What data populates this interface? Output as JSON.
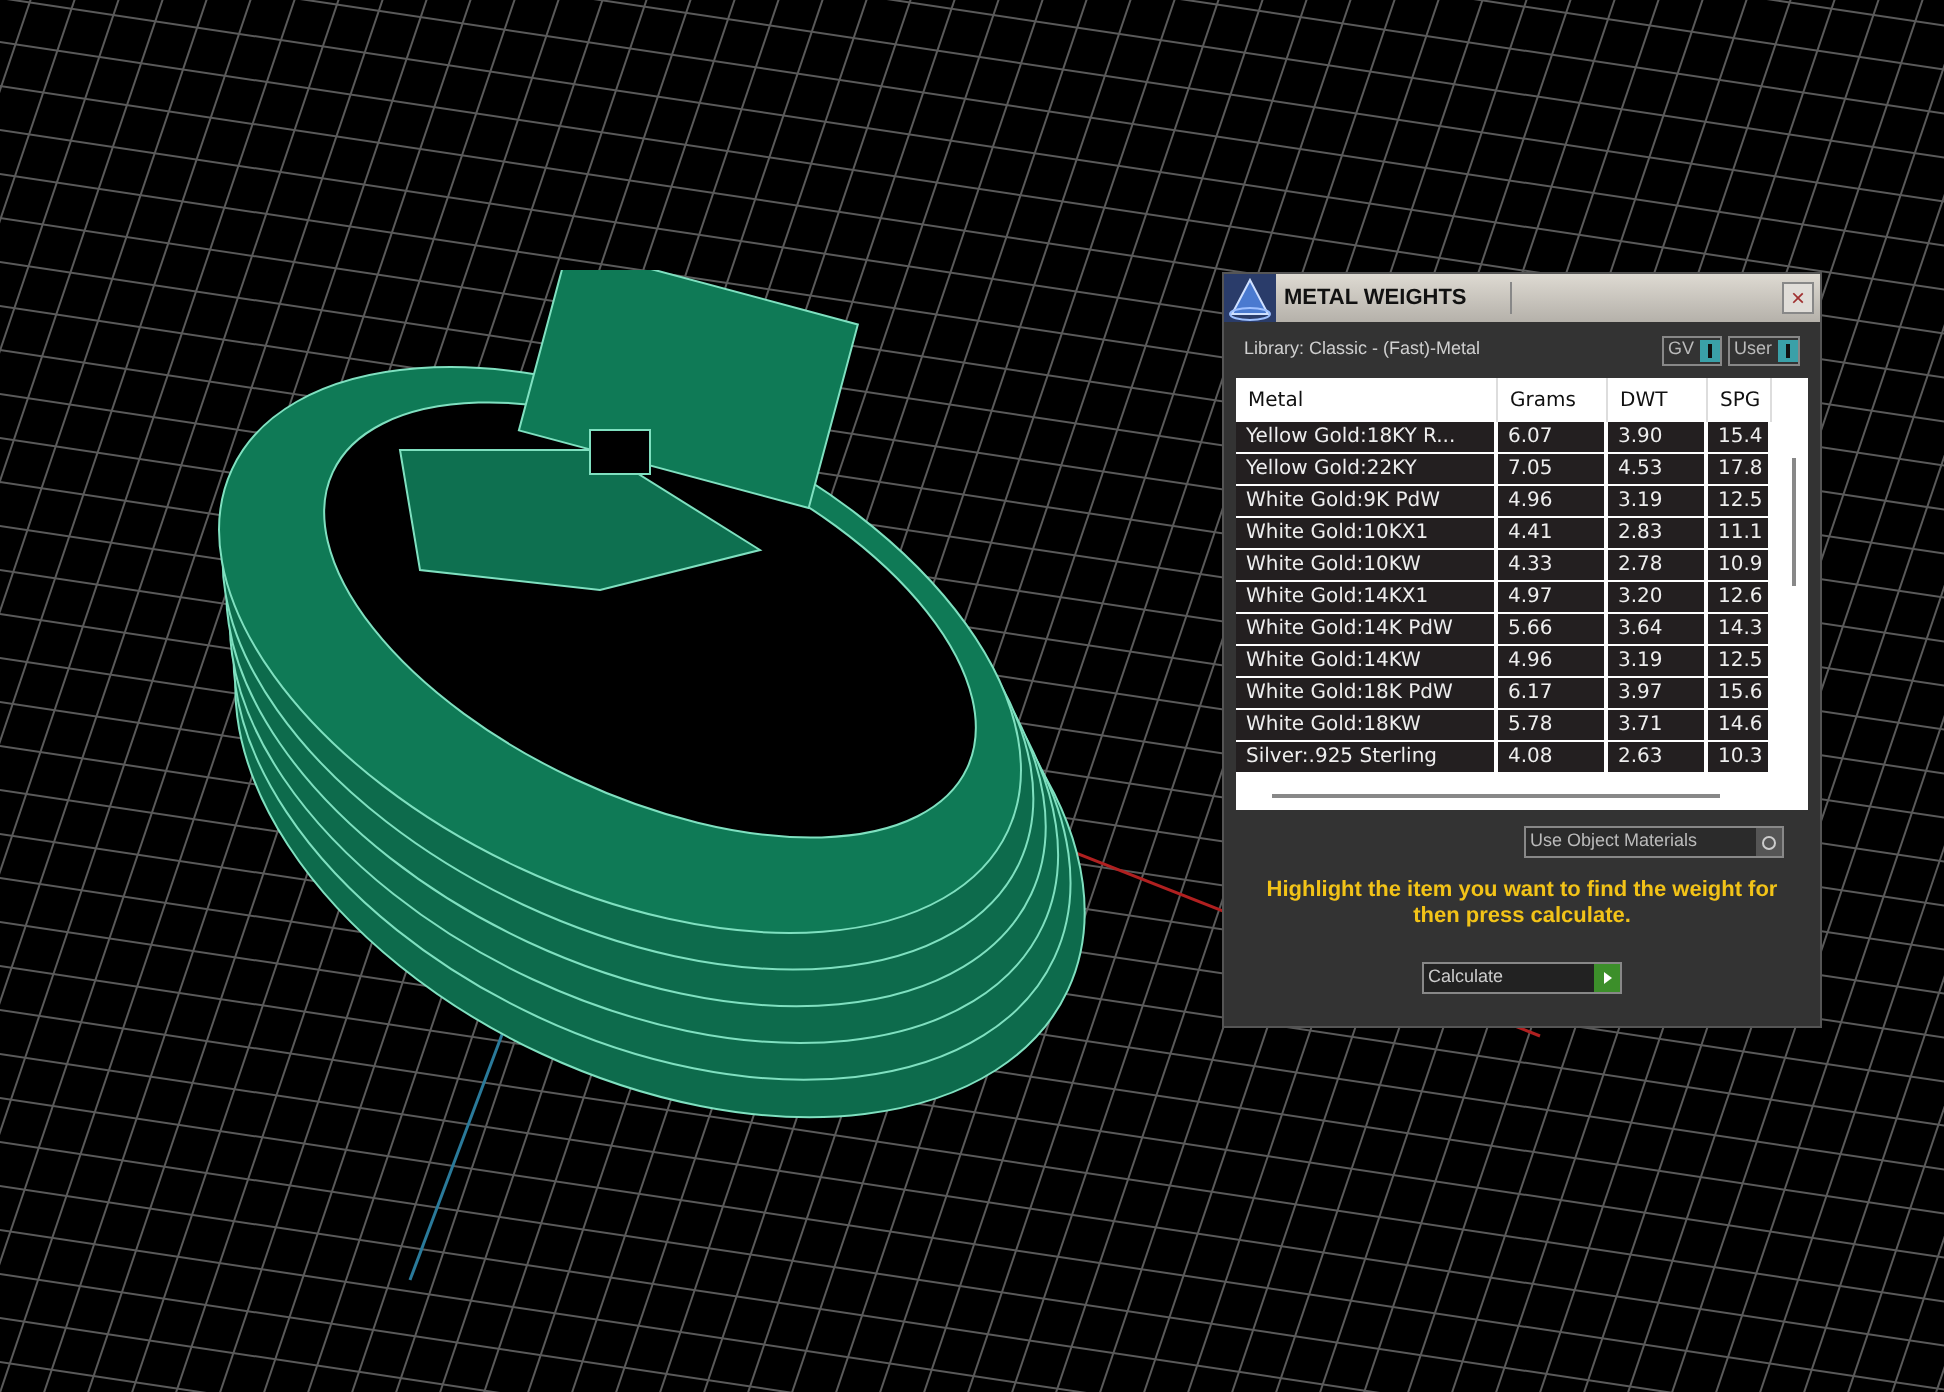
{
  "panel": {
    "title": "METAL WEIGHTS",
    "close": "×",
    "library": "Library: Classic - (Fast)-Metal",
    "toggles": [
      {
        "label": "GV",
        "on": true
      },
      {
        "label": "User",
        "on": true
      }
    ],
    "table": {
      "columns": [
        "Metal",
        "Grams",
        "DWT",
        "SPG"
      ],
      "rows": [
        {
          "metal": "Yellow Gold:18KY R...",
          "grams": "6.07",
          "dwt": "3.90",
          "spg": "15.4"
        },
        {
          "metal": "Yellow Gold:22KY",
          "grams": "7.05",
          "dwt": "4.53",
          "spg": "17.8"
        },
        {
          "metal": "White Gold:9K PdW",
          "grams": "4.96",
          "dwt": "3.19",
          "spg": "12.5"
        },
        {
          "metal": "White Gold:10KX1",
          "grams": "4.41",
          "dwt": "2.83",
          "spg": "11.1"
        },
        {
          "metal": "White Gold:10KW",
          "grams": "4.33",
          "dwt": "2.78",
          "spg": "10.9"
        },
        {
          "metal": "White Gold:14KX1",
          "grams": "4.97",
          "dwt": "3.20",
          "spg": "12.6"
        },
        {
          "metal": "White Gold:14K PdW",
          "grams": "5.66",
          "dwt": "3.64",
          "spg": "14.3"
        },
        {
          "metal": "White Gold:14KW",
          "grams": "4.96",
          "dwt": "3.19",
          "spg": "12.5"
        },
        {
          "metal": "White Gold:18K PdW",
          "grams": "6.17",
          "dwt": "3.97",
          "spg": "15.6"
        },
        {
          "metal": "White Gold:18KW",
          "grams": "5.78",
          "dwt": "3.71",
          "spg": "14.6"
        },
        {
          "metal": "Silver:.925 Sterling",
          "grams": "4.08",
          "dwt": "2.63",
          "spg": "10.3"
        }
      ]
    },
    "use_object_materials": {
      "label": "Use Object Materials",
      "on": false
    },
    "hint": "Highlight the item you want to find the weight for then press calculate.",
    "calculate": "Calculate"
  }
}
